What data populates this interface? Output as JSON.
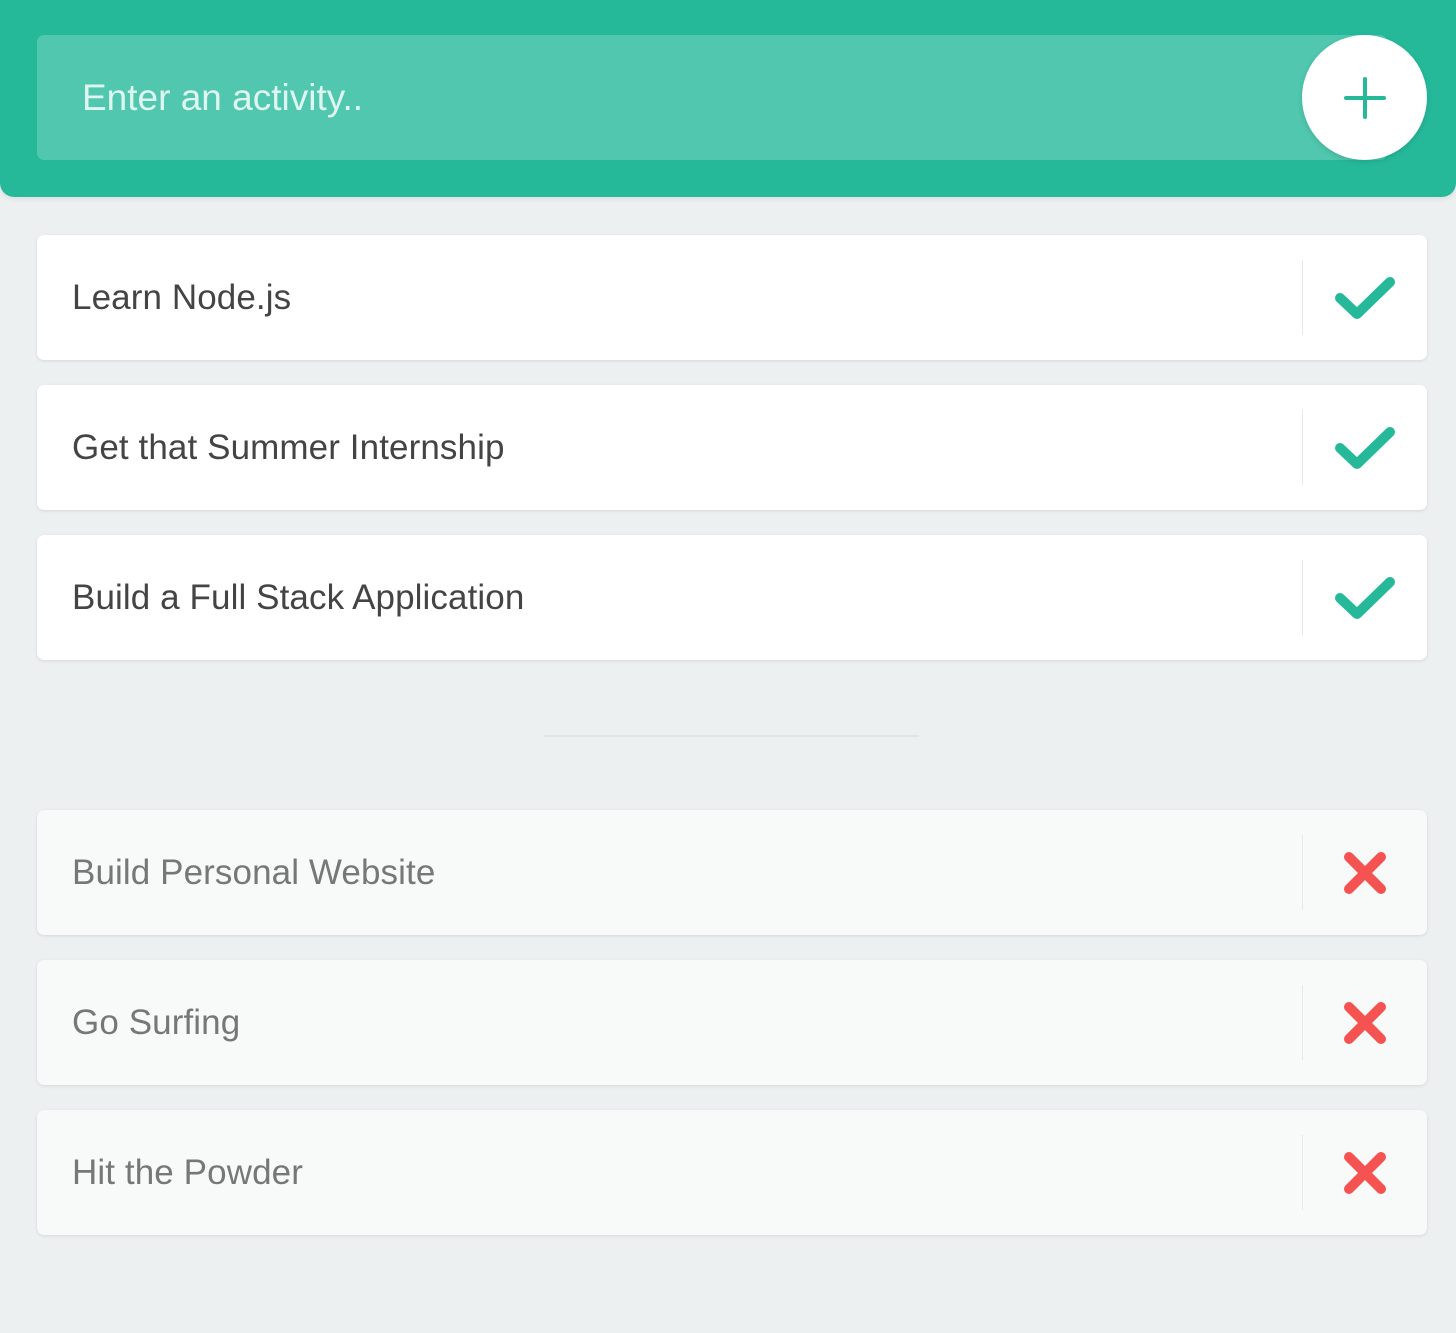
{
  "colors": {
    "accent": "#25b99a",
    "check": "#25b99a",
    "remove": "#f55252",
    "background": "#ecf0f1"
  },
  "header": {
    "input": {
      "placeholder": "Enter an activity..",
      "value": ""
    },
    "add_button": {
      "icon": "plus-icon"
    }
  },
  "todo": {
    "items": [
      {
        "label": "Learn Node.js",
        "action_icon": "check-icon"
      },
      {
        "label": "Get that Summer Internship",
        "action_icon": "check-icon"
      },
      {
        "label": "Build a Full Stack Application",
        "action_icon": "check-icon"
      }
    ]
  },
  "completed": {
    "items": [
      {
        "label": "Build Personal Website",
        "action_icon": "close-icon"
      },
      {
        "label": "Go Surfing",
        "action_icon": "close-icon"
      },
      {
        "label": "Hit the Powder",
        "action_icon": "close-icon"
      }
    ]
  }
}
